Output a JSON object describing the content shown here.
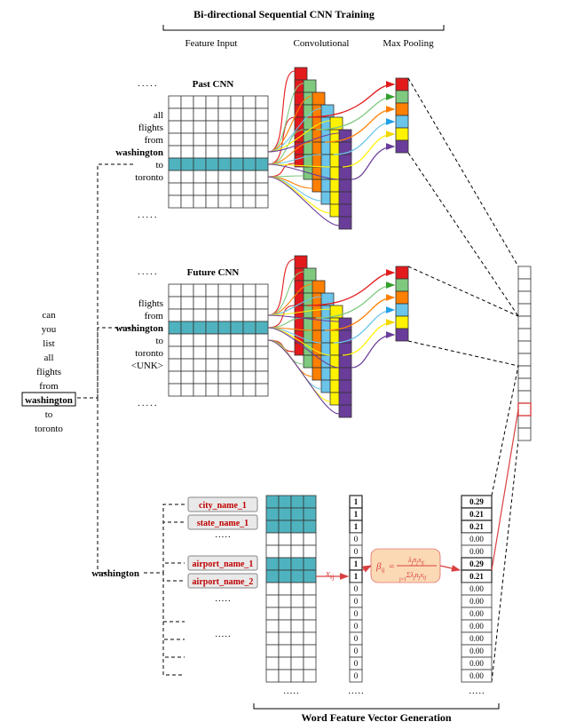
{
  "title_top": "Bi-directional Sequential CNN Training",
  "header": {
    "feature": "Feature Input",
    "conv": "Convolutional",
    "pool": "Max Pooling"
  },
  "past_label": "Past CNN",
  "future_label": "Future CNN",
  "sentence": [
    "can",
    "you",
    "list",
    "all",
    "flights",
    "from",
    "washington",
    "to",
    "toronto"
  ],
  "sentence_boxed": "washington",
  "past_words": [
    "all",
    "flights",
    "from",
    "washington",
    "to",
    "toronto"
  ],
  "future_words": [
    "flights",
    "from",
    "washington",
    "to",
    "toronto",
    "<UNK>"
  ],
  "dots": "·····",
  "wfv_label": "Word Feature Vector Generation",
  "feat_word": "washington",
  "feat_tags": [
    "city_name_1",
    "state_name_1",
    "airport_name_1",
    "airport_name_2"
  ],
  "xij": "x",
  "xij_sub": "ij",
  "formula_beta": "β",
  "formula_sub": "ij",
  "formula_eq": "=",
  "formula_num": "λ n x",
  "formula_den": "Σ λ n x",
  "ones": [
    "1",
    "1",
    "1",
    "0",
    "0",
    "1",
    "1",
    "0",
    "0",
    "0",
    "0",
    "0",
    "0",
    "0",
    "0"
  ],
  "betas": [
    "0.29",
    "0.21",
    "0.21",
    "0.00",
    "0.00",
    "0.29",
    "0.21",
    "0.00",
    "0.00",
    "0.00",
    "0.00",
    "0.00",
    "0.00",
    "0.00",
    "0.00"
  ],
  "chart_data": {
    "type": "table",
    "title": "Word feature β values",
    "categories": [
      "city_name_1",
      "state_name_1",
      "_slot3_",
      "_slot4_",
      "_slot5_",
      "airport_name_1",
      "airport_name_2",
      "_slot8_",
      "_slot9_",
      "_slot10_",
      "_slot11_",
      "_slot12_",
      "_slot13_",
      "_slot14_",
      "_slot15_"
    ],
    "series": [
      {
        "name": "x_ij",
        "values": [
          1,
          1,
          1,
          0,
          0,
          1,
          1,
          0,
          0,
          0,
          0,
          0,
          0,
          0,
          0
        ]
      },
      {
        "name": "beta_ij",
        "values": [
          0.29,
          0.21,
          0.21,
          0.0,
          0.0,
          0.29,
          0.21,
          0.0,
          0.0,
          0.0,
          0.0,
          0.0,
          0.0,
          0.0,
          0.0
        ]
      }
    ]
  }
}
